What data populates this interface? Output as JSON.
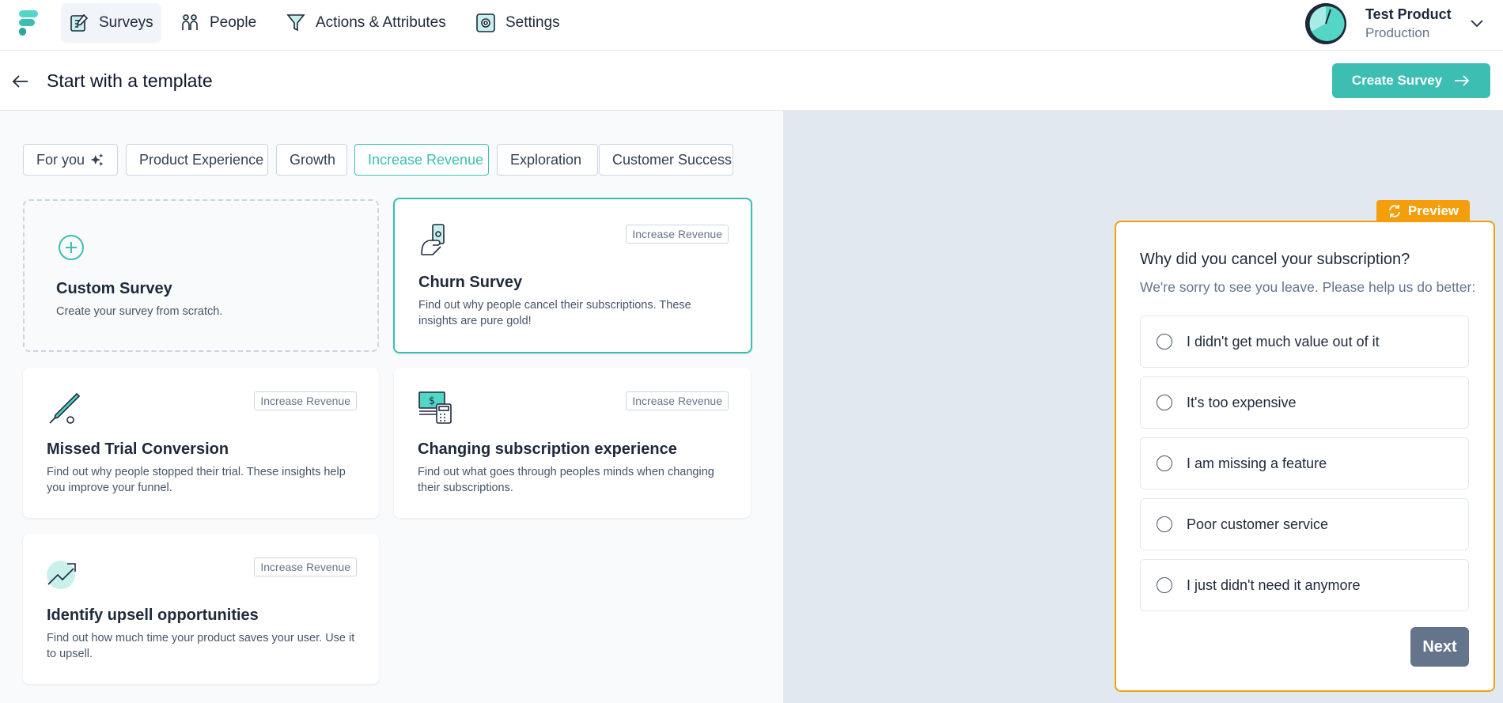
{
  "nav": {
    "items": [
      {
        "label": "Surveys",
        "icon": "surveys-icon",
        "active": true
      },
      {
        "label": "People",
        "icon": "people-icon"
      },
      {
        "label": "Actions & Attributes",
        "icon": "filter-funnel-icon"
      },
      {
        "label": "Settings",
        "icon": "settings-gear-icon"
      }
    ],
    "product_name": "Test Product",
    "environment": "Production"
  },
  "header": {
    "title": "Start with a template",
    "create_label": "Create Survey"
  },
  "filters": [
    {
      "label": "For you",
      "active": false
    },
    {
      "label": "Product Experience",
      "active": false
    },
    {
      "label": "Growth",
      "active": false
    },
    {
      "label": "Increase Revenue",
      "active": true
    },
    {
      "label": "Exploration",
      "active": false
    },
    {
      "label": "Customer Success",
      "active": false
    }
  ],
  "templates": {
    "custom": {
      "title": "Custom Survey",
      "description": "Create your survey from scratch."
    },
    "churn": {
      "title": "Churn Survey",
      "tag": "Increase Revenue",
      "description": "Find out why people cancel their subscriptions. These insights are pure gold!"
    },
    "trial": {
      "title": "Missed Trial Conversion",
      "tag": "Increase Revenue",
      "description": "Find out why people stopped their trial. These insights help you improve your funnel."
    },
    "subscription": {
      "title": "Changing subscription experience",
      "tag": "Increase Revenue",
      "description": "Find out what goes through peoples minds when changing their subscriptions."
    },
    "upsell": {
      "title": "Identify upsell opportunities",
      "tag": "Increase Revenue",
      "description": "Find out how much time your product saves your user. Use it to upsell."
    }
  },
  "preview": {
    "badge": "Preview",
    "question": "Why did you cancel your subscription?",
    "subheader": "We're sorry to see you leave. Please help us do better:",
    "options": [
      "I didn't get much value out of it",
      "It's too expensive",
      "I am missing a feature",
      "Poor customer service",
      "I just didn't need it anymore"
    ],
    "next_label": "Next"
  },
  "colors": {
    "brand": "#3cbfb2",
    "preview_accent": "#f59e0b",
    "next_button": "#64748b"
  }
}
